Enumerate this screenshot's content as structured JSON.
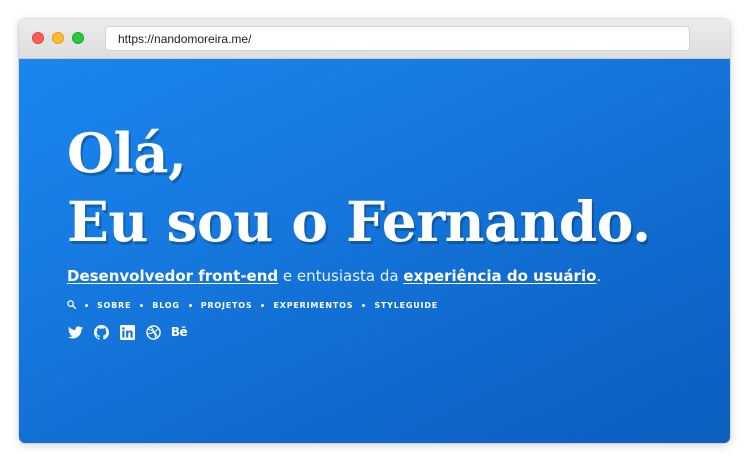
{
  "browser": {
    "url": "https://nandomoreira.me/"
  },
  "hero": {
    "greeting": "Olá,",
    "name": "Eu sou o Fernando."
  },
  "tagline": {
    "role_link": "Desenvolvedor front-end",
    "middle_text": " e entusiasta da ",
    "ux_link": "experiência do usuário",
    "end_text": "."
  },
  "nav": {
    "search_icon": "search-icon",
    "items": [
      {
        "label": "Sobre"
      },
      {
        "label": "Blog"
      },
      {
        "label": "Projetos"
      },
      {
        "label": "Experimentos"
      },
      {
        "label": "Styleguide"
      }
    ]
  },
  "social": {
    "icons": [
      "twitter-icon",
      "github-icon",
      "linkedin-icon",
      "dribbble-icon",
      "behance-icon"
    ],
    "behance_text": "Bē"
  },
  "colors": {
    "background_start": "#1a86f0",
    "background_end": "#0b5fbf",
    "text": "#ffffff"
  }
}
